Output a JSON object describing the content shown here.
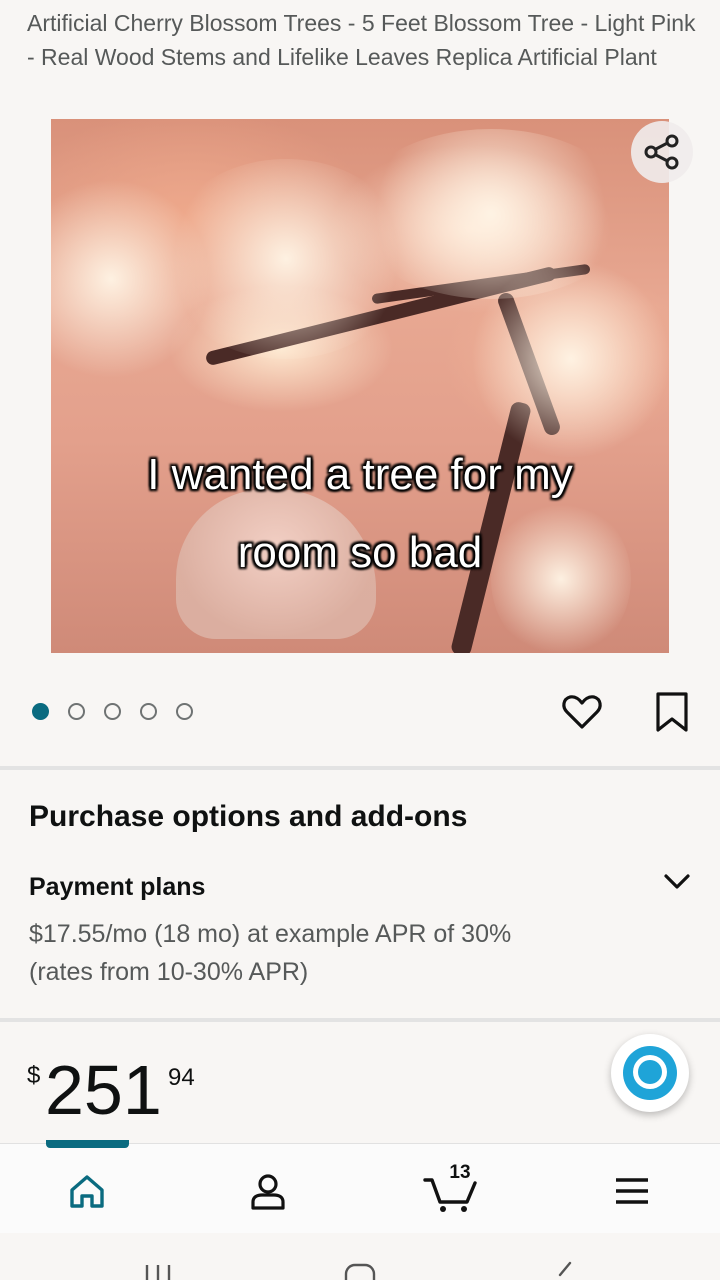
{
  "product": {
    "title": "Artificial Cherry Blossom Trees - 5 Feet Blossom Tree - Light Pink - Real Wood Stems and Lifelike Leaves Replica Artificial Plant"
  },
  "gallery": {
    "caption_line1": "I wanted a tree for my",
    "caption_line2": "room so bad",
    "dot_count": 5,
    "active_index": 0
  },
  "purchase": {
    "section_title": "Purchase options and add-ons",
    "payment_plans_title": "Payment plans",
    "payment_plans_desc": "$17.55/mo (18 mo) at example APR of 30% (rates from 10-30% APR)"
  },
  "price": {
    "symbol": "$",
    "whole": "251",
    "fraction": "94"
  },
  "nav": {
    "cart_count": "13",
    "active": "home"
  },
  "colors": {
    "accent": "#0a6b80",
    "text": "#0f1111",
    "muted": "#565959",
    "alexa": "#1fa4d8"
  }
}
